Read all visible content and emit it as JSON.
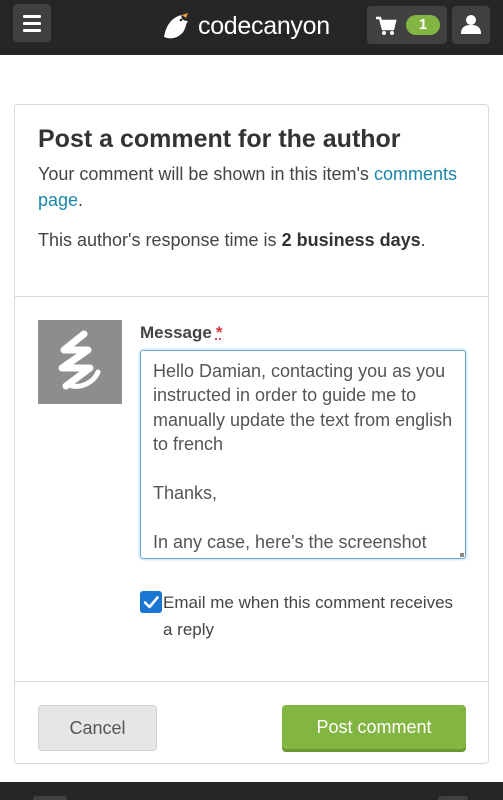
{
  "header": {
    "logo_text": "codecanyon",
    "cart_count": "1",
    "menu_icon": "hamburger-icon",
    "cart_icon": "cart-icon",
    "user_icon": "user-icon",
    "accent": "#82b541"
  },
  "card": {
    "title": "Post a comment for the author",
    "intro_text": "Your comment will be shown in this item's",
    "intro_link": "comments page",
    "intro_end": ".",
    "response_prefix": "This author's response time is",
    "response_value": "2 business days",
    "response_end": "."
  },
  "form": {
    "message_label": "Message",
    "required_mark": "*",
    "message_value": "Hello Damian, contacting you as you instructed in order to guide me to manually update the text from english to french\n\nThanks,\n\nIn any case, here's the screenshot",
    "email_checkbox_checked": true,
    "email_checkbox_label": "Email me when this comment receives a reply",
    "cancel_label": "Cancel",
    "post_label": "Post comment"
  }
}
